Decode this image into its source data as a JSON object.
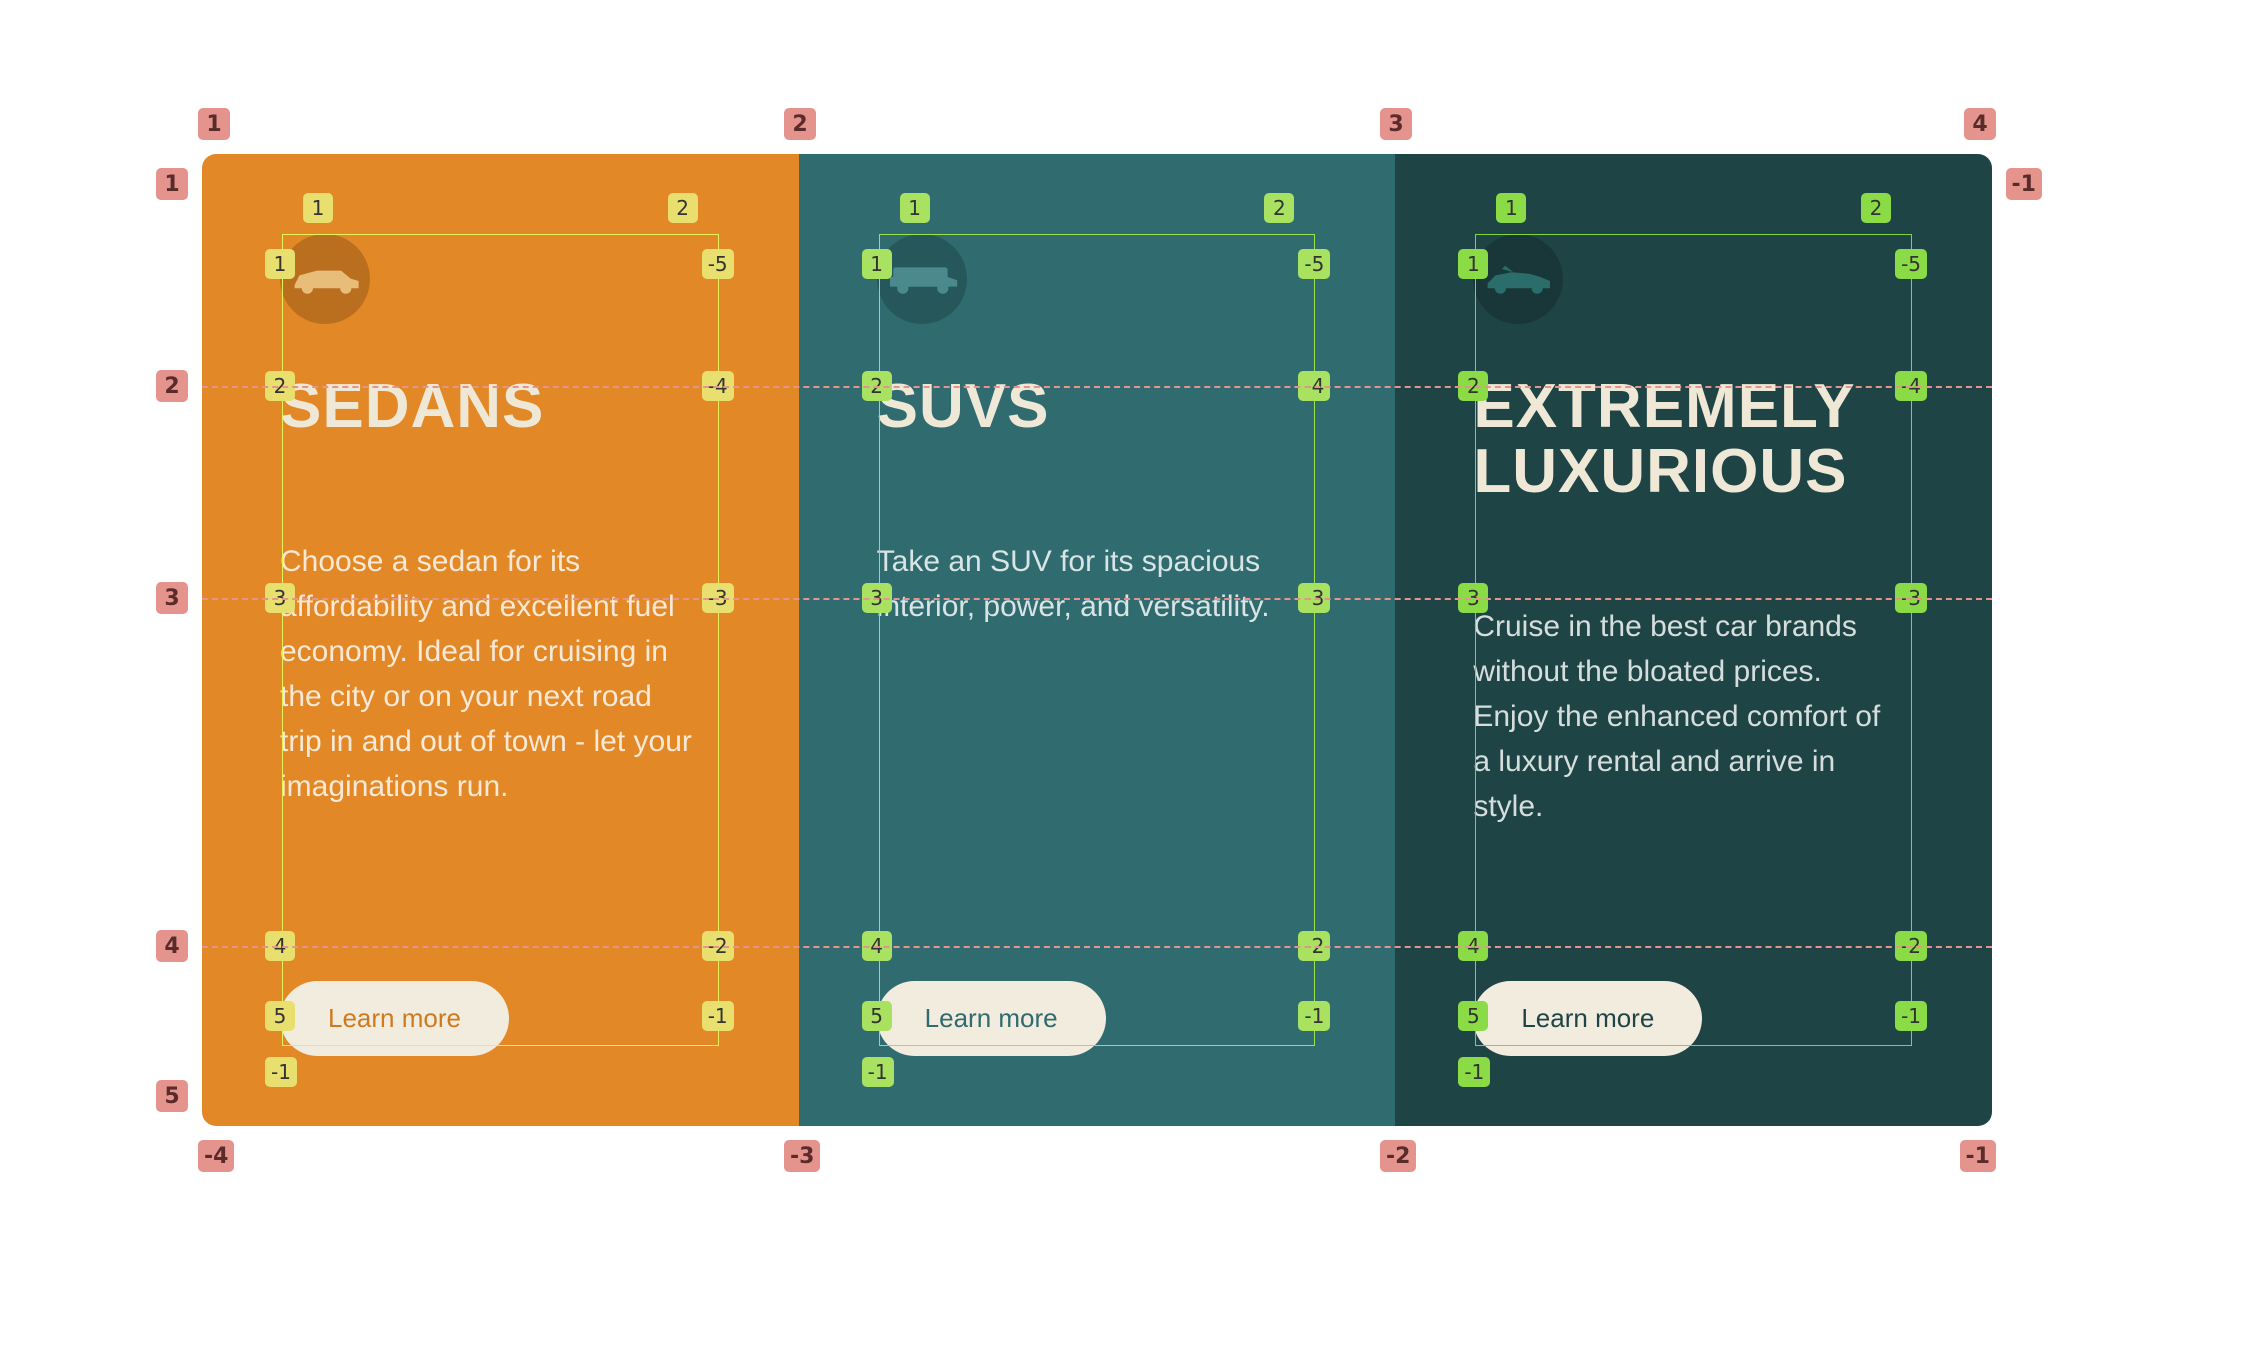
{
  "cards": [
    {
      "title": "SEDANS",
      "desc": "Choose a sedan for its affordability and excellent fuel economy. Ideal for cruising in the city or on your next road trip in and out of town - let your imaginations run.",
      "button": "Learn more",
      "icon": "sedan",
      "corner_labels": [
        "1",
        "2",
        "1",
        "-5",
        "2",
        "-4",
        "3",
        "-3",
        "4",
        "-2",
        "5",
        "-1",
        "-1"
      ]
    },
    {
      "title": "SUVS",
      "desc": "Take an SUV for its spacious interior, power, and versatility.",
      "button": "Learn more",
      "icon": "suv",
      "corner_labels": [
        "1",
        "2",
        "1",
        "-5",
        "2",
        "-4",
        "3",
        "-3",
        "4",
        "-2",
        "5",
        "-1",
        "-1"
      ]
    },
    {
      "title": "EXTREMELY LUXURIOUS",
      "desc": "Cruise in the best car brands without the bloated prices. Enjoy the enhanced comfort of a luxury rental and arrive in style.",
      "button": "Learn more",
      "icon": "convertible",
      "corner_labels": [
        "1",
        "2",
        "1",
        "-5",
        "2",
        "-4",
        "3",
        "-3",
        "4",
        "-2",
        "5",
        "-1",
        "-1"
      ]
    }
  ],
  "outer_top_labels": [
    "1",
    "2",
    "3",
    "4"
  ],
  "outer_left_labels": [
    "1",
    "2",
    "3",
    "4",
    "5"
  ],
  "outer_right_label": "-1",
  "outer_bottom_labels": [
    "-4",
    "-3",
    "-2",
    "-1"
  ]
}
